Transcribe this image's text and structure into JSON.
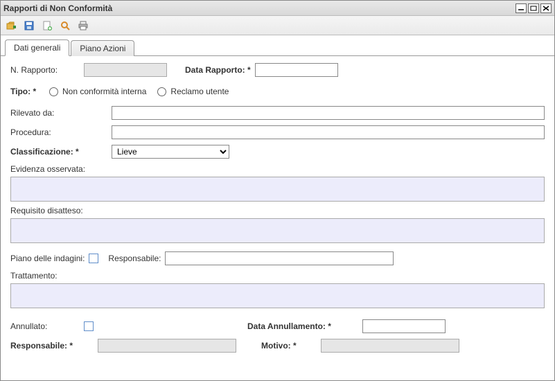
{
  "window": {
    "title": "Rapporti di Non Conformità"
  },
  "tabs": [
    {
      "label": "Dati generali",
      "active": true
    },
    {
      "label": "Piano Azioni",
      "active": false
    }
  ],
  "form": {
    "nRapportoLabel": "N. Rapporto:",
    "nRapportoValue": "",
    "dataRapportoLabel": "Data Rapporto: *",
    "dataRapportoValue": "",
    "tipoLabel": "Tipo: *",
    "tipoOption1": "Non conformità interna",
    "tipoOption2": "Reclamo utente",
    "rilevatoDaLabel": "Rilevato da:",
    "rilevatoDaValue": "",
    "proceduraLabel": "Procedura:",
    "proceduraValue": "",
    "classificazioneLabel": "Classificazione: *",
    "classificazioneValue": "Lieve",
    "evidenzaLabel": "Evidenza osservata:",
    "requisitoLabel": "Requisito disatteso:",
    "pianoIndaginiLabel": "Piano delle indagini:",
    "responsabileTopLabel": "Responsabile:",
    "responsabileTopValue": "",
    "trattamentoLabel": "Trattamento:",
    "annullatoLabel": "Annullato:",
    "dataAnnullamentoLabel": "Data Annullamento: *",
    "dataAnnullamentoValue": "",
    "responsabileBotLabel": "Responsabile: *",
    "responsabileBotValue": "",
    "motivoLabel": "Motivo: *",
    "motivoValue": ""
  }
}
